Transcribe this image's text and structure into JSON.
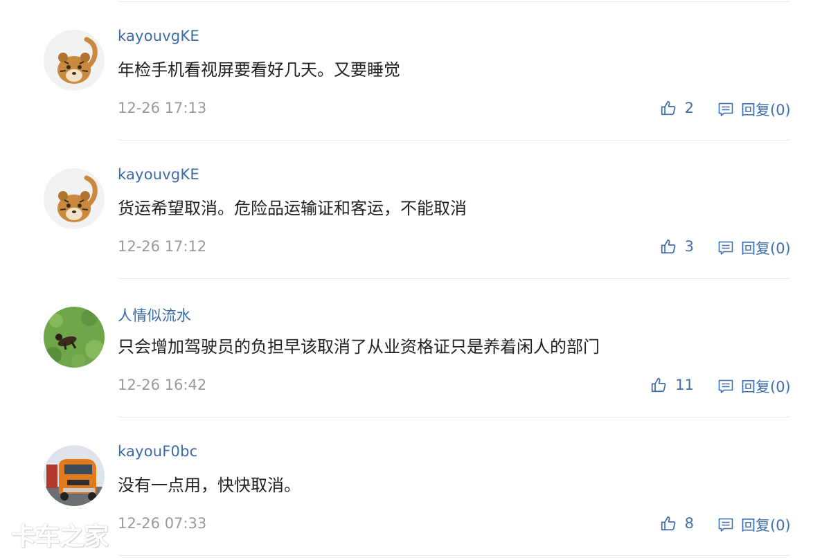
{
  "comments": [
    {
      "username": "kayouvgKE",
      "text": "年检手机看视屏要看好几天。又要睡觉",
      "time": "12-26 17:13",
      "likes": "2",
      "reply": "回复(0)",
      "avatar": "tiger-avatar"
    },
    {
      "username": "kayouvgKE",
      "text": "货运希望取消。危险品运输证和客运，不能取消",
      "time": "12-26 17:12",
      "likes": "3",
      "reply": "回复(0)",
      "avatar": "tiger-avatar"
    },
    {
      "username": "人情似流水",
      "text": "只会增加驾驶员的负担早该取消了从业资格证只是养着闲人的部门",
      "time": "12-26 16:42",
      "likes": "11",
      "reply": "回复(0)",
      "avatar": "dog-on-grass-avatar"
    },
    {
      "username": "kayouF0bc",
      "text": "没有一点用，快快取消。",
      "time": "12-26 07:33",
      "likes": "8",
      "reply": "回复(0)",
      "avatar": "truck-avatar"
    }
  ],
  "watermark": "卡车之家",
  "colors": {
    "username": "#3a6aa6",
    "action": "#3d6db0",
    "timestamp": "#9a9a9a",
    "text": "#222222",
    "divider": "#e9eaed"
  },
  "icons": {
    "like": "thumbs-up-icon",
    "reply": "comment-icon"
  }
}
